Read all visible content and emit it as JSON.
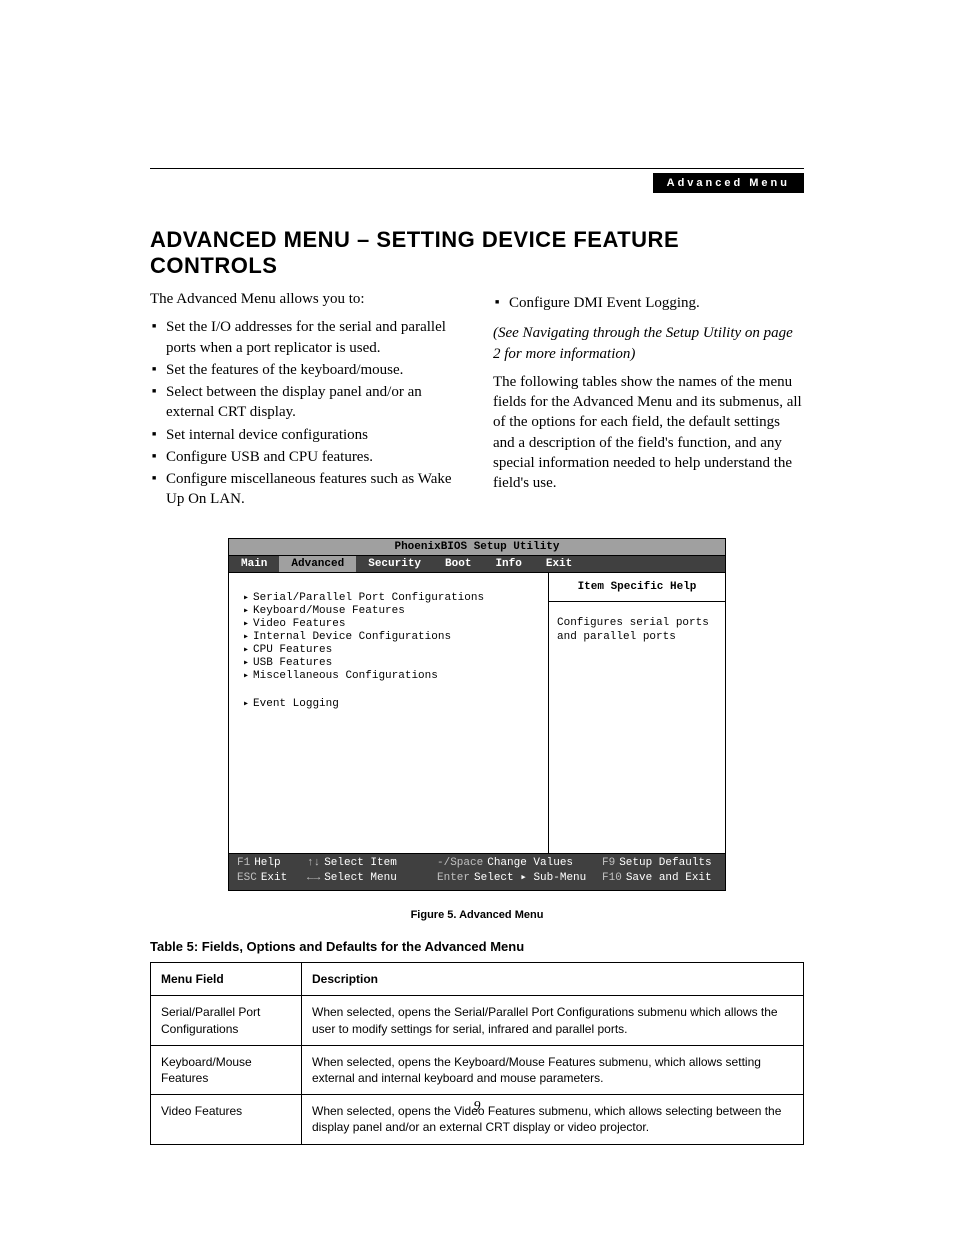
{
  "header": {
    "section_label": "Advanced Menu"
  },
  "title": "ADVANCED MENU – SETTING DEVICE FEATURE CONTROLS",
  "intro_left": {
    "lead": "The Advanced Menu allows you to:",
    "bullets": [
      "Set the I/O addresses for the serial and parallel ports when a port replicator is used.",
      "Set the features of the keyboard/mouse.",
      "Select between the display panel and/or an external CRT display.",
      "Set internal device configurations",
      "Configure USB and CPU features.",
      "Configure miscellaneous features such as Wake Up On LAN."
    ]
  },
  "intro_right": {
    "top_bullet": "Configure DMI Event Logging.",
    "note": "(See Navigating through the Setup Utility on page 2 for more information)",
    "para": "The following tables show the names of the menu fields for the Advanced Menu and its submenus, all of the options for each field, the default settings and a description of the field's function, and any special information needed to help understand the field's use."
  },
  "bios": {
    "title": "PhoenixBIOS Setup Utility",
    "menus": [
      "Main",
      "Advanced",
      "Security",
      "Boot",
      "Info",
      "Exit"
    ],
    "selected_menu": "Advanced",
    "items": [
      "Serial/Parallel Port Configurations",
      "Keyboard/Mouse Features",
      "Video Features",
      "Internal Device Configurations",
      "CPU Features",
      "USB Features",
      "Miscellaneous Configurations"
    ],
    "extra_item": "Event Logging",
    "help_heading": "Item Specific Help",
    "help_text": "Configures serial ports and parallel ports",
    "footer": {
      "f1": "F1",
      "help": "Help",
      "esc": "ESC",
      "exit": "Exit",
      "updown": "↑↓",
      "select_item": "Select Item",
      "leftright": "←→",
      "select_menu": "Select Menu",
      "minusspace": "-/Space",
      "change_values": "Change Values",
      "enter": "Enter",
      "select_sub": "Select ▸ Sub-Menu",
      "f9": "F9",
      "setup_defaults": "Setup Defaults",
      "f10": "F10",
      "save_exit": "Save and Exit"
    }
  },
  "figure_caption": "Figure 5.   Advanced Menu",
  "table_caption": "Table 5: Fields, Options and Defaults for the Advanced Menu",
  "table": {
    "head": {
      "a": "Menu Field",
      "b": "Description"
    },
    "rows": [
      {
        "a": "Serial/Parallel Port Configurations",
        "b": "When selected, opens the Serial/Parallel Port Configurations submenu which allows the user to modify settings for serial, infrared and parallel ports."
      },
      {
        "a": "Keyboard/Mouse Features",
        "b": "When selected, opens the Keyboard/Mouse Features submenu, which allows setting external and internal keyboard and mouse parameters."
      },
      {
        "a": "Video Features",
        "b": "When selected, opens the Video Features submenu, which allows selecting between the display panel and/or an external CRT display or video projector."
      }
    ]
  },
  "page_number": "9"
}
